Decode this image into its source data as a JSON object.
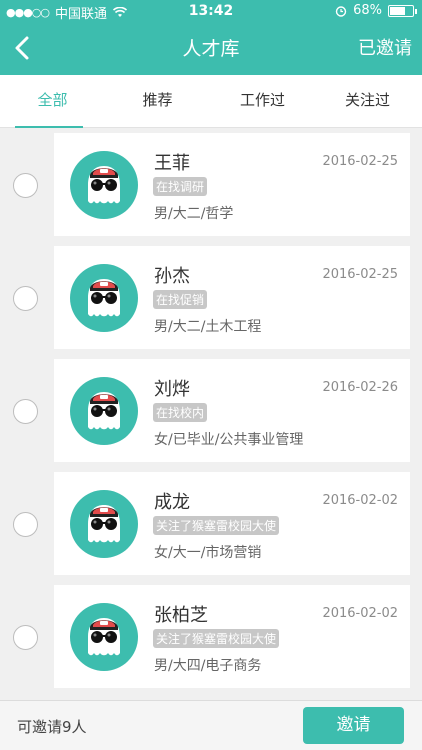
{
  "status_bar": {
    "carrier": "中国联通",
    "time": "13:42",
    "battery_text": "68%",
    "battery_level": 0.68
  },
  "nav": {
    "title": "人才库",
    "right_label": "已邀请"
  },
  "tabs": [
    {
      "label": "全部",
      "active": true
    },
    {
      "label": "推荐",
      "active": false
    },
    {
      "label": "工作过",
      "active": false
    },
    {
      "label": "关注过",
      "active": false
    }
  ],
  "candidates": [
    {
      "name": "王菲",
      "date": "2016-02-25",
      "tag": "在找调研",
      "info": "男/大二/哲学"
    },
    {
      "name": "孙杰",
      "date": "2016-02-25",
      "tag": "在找促销",
      "info": "男/大二/土木工程"
    },
    {
      "name": "刘烨",
      "date": "2016-02-26",
      "tag": "在找校内",
      "info": "女/已毕业/公共事业管理"
    },
    {
      "name": "成龙",
      "date": "2016-02-02",
      "tag": "关注了猴塞雷校园大使",
      "info": "女/大一/市场营销"
    },
    {
      "name": "张柏芝",
      "date": "2016-02-02",
      "tag": "关注了猴塞雷校园大使",
      "info": "男/大四/电子商务"
    }
  ],
  "footer": {
    "invite_count_text": "可邀请9人",
    "invite_button": "邀请"
  },
  "colors": {
    "accent": "#3dbdae",
    "tag_bg": "#c7c7c7"
  }
}
